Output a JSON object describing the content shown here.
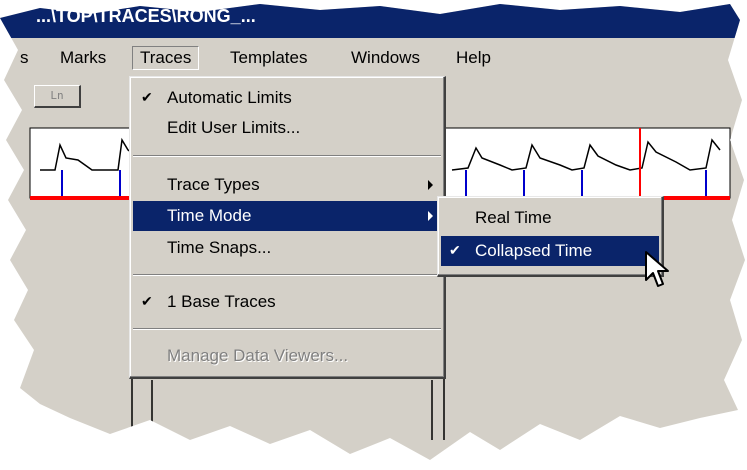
{
  "window": {
    "title": "...\\TOP\\TRACES\\RONG_..."
  },
  "menubar": {
    "items": [
      {
        "label": "s",
        "active": false
      },
      {
        "label": "Marks",
        "active": false
      },
      {
        "label": "Traces",
        "active": true
      },
      {
        "label": "Templates",
        "active": false
      },
      {
        "label": "Windows",
        "active": false
      },
      {
        "label": "Help",
        "active": false
      }
    ]
  },
  "toolbar": {
    "button_label": "Ln"
  },
  "traces_menu": {
    "items": [
      {
        "label": "Automatic Limits",
        "checked": true
      },
      {
        "label": "Edit User Limits..."
      },
      {
        "label": "Trace Types",
        "submenu": true
      },
      {
        "label": "Time Mode",
        "submenu": true,
        "highlighted": true
      },
      {
        "label": "Time Snaps..."
      },
      {
        "label": "1 Base Traces",
        "checked": true
      },
      {
        "label": "Manage Data Viewers...",
        "disabled": true
      }
    ]
  },
  "time_mode_submenu": {
    "items": [
      {
        "label": "Real Time",
        "checked": false
      },
      {
        "label": "Collapsed Time",
        "checked": true,
        "highlighted": true
      }
    ]
  },
  "icons": {
    "check": "checkmark-icon",
    "submenu_arrow": "submenu-arrow-icon",
    "cursor": "mouse-pointer-icon"
  },
  "colors": {
    "menu_face": "#d4d0c8",
    "highlight": "#0a246a",
    "title_bar": "#0a246a",
    "limit_line": "#ff0000",
    "marker": "#0000cc"
  }
}
